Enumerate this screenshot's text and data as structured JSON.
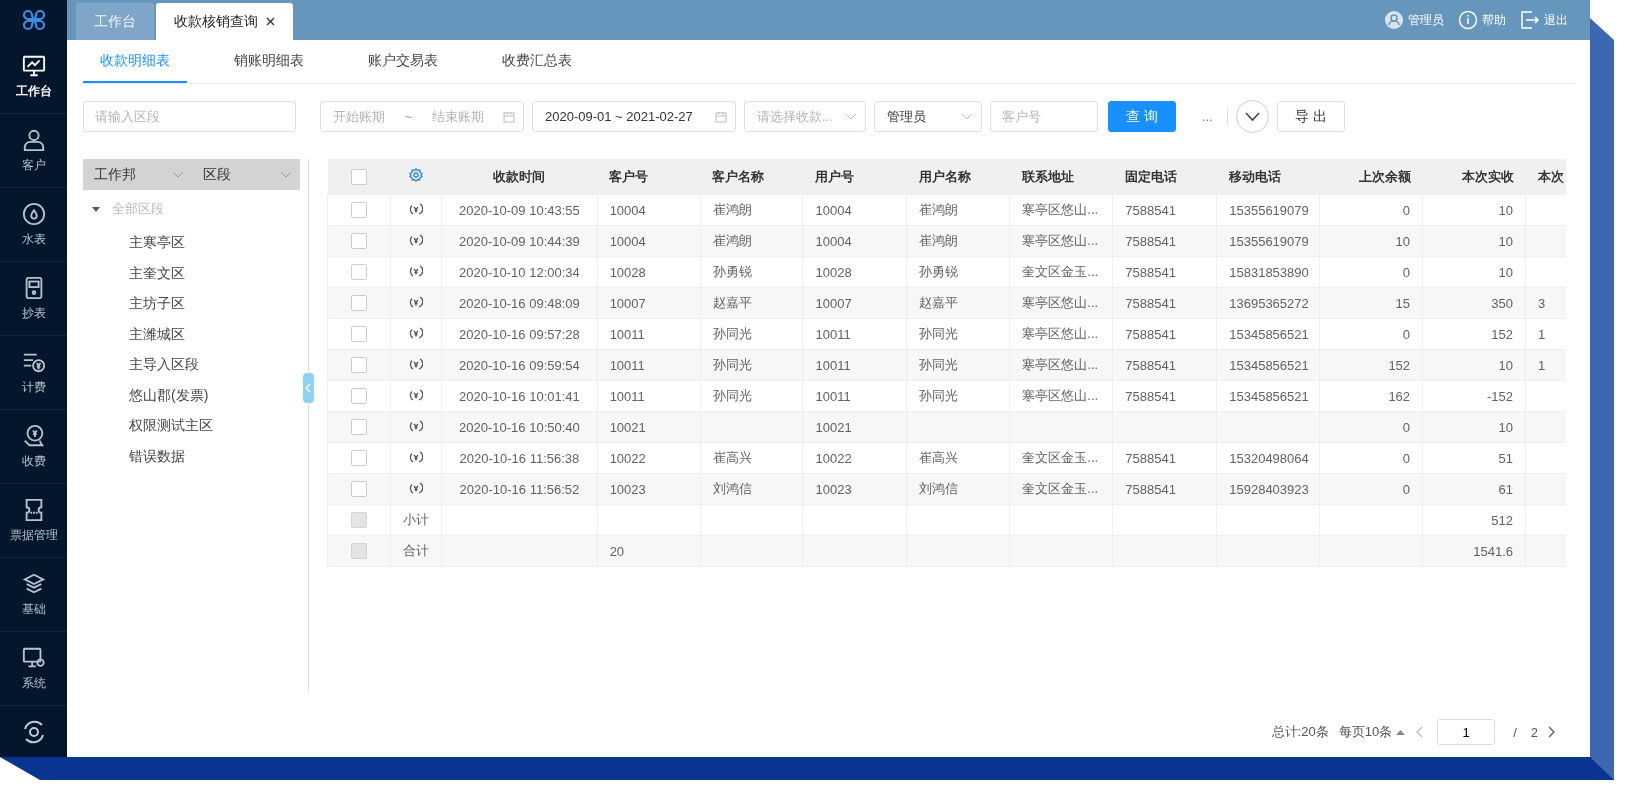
{
  "sidebar": {
    "items": [
      {
        "label": "工作台",
        "selected": true
      },
      {
        "label": "客户",
        "selected": false
      },
      {
        "label": "水表",
        "selected": false
      },
      {
        "label": "抄表",
        "selected": false
      },
      {
        "label": "计费",
        "selected": false
      },
      {
        "label": "收费",
        "selected": false
      },
      {
        "label": "票据管理",
        "selected": false
      },
      {
        "label": "基础",
        "selected": false
      },
      {
        "label": "系统",
        "selected": false
      }
    ]
  },
  "tabs": [
    {
      "label": "工作台",
      "selected": false,
      "closable": false
    },
    {
      "label": "收款核销查询",
      "selected": true,
      "closable": true
    }
  ],
  "user_menu": [
    {
      "label": "管理员"
    },
    {
      "label": "帮助"
    },
    {
      "label": "退出"
    }
  ],
  "subtabs": [
    {
      "label": "收款明细表",
      "selected": true
    },
    {
      "label": "销账明细表",
      "selected": false
    },
    {
      "label": "账户交易表",
      "selected": false
    },
    {
      "label": "收费汇总表",
      "selected": false
    }
  ],
  "filters": {
    "region": {
      "placeholder": "请输入区段"
    },
    "period": {
      "start_placeholder": "开始账期",
      "separator": "~",
      "end_placeholder": "结束账期"
    },
    "date_range": {
      "value": "2020-09-01 ~ 2021-02-27"
    },
    "payment_select": {
      "placeholder": "请选择收款..."
    },
    "operator_select": {
      "value": "管理员"
    },
    "customer": {
      "placeholder": "客户号"
    },
    "query_button": "查 询",
    "more": "...",
    "export_button": "导 出"
  },
  "left_panel": {
    "selects": [
      "工作邦",
      "区段"
    ],
    "tree": {
      "label": "全部区段",
      "expanded": true,
      "disabled": true,
      "children": [
        {
          "label": "主寒亭区"
        },
        {
          "label": "主奎文区"
        },
        {
          "label": "主坊子区"
        },
        {
          "label": "主潍城区"
        },
        {
          "label": "主导入区段"
        },
        {
          "label": "悠山郡(发票)"
        },
        {
          "label": "权限测试主区"
        },
        {
          "label": "错误数据"
        }
      ]
    }
  },
  "table": {
    "columns": [
      "收款时间",
      "客户号",
      "客户名称",
      "用户号",
      "用户名称",
      "联系地址",
      "固定电话",
      "移动电话",
      "上次余额",
      "本次实收",
      "本次"
    ],
    "select_all_checked": false,
    "rows": [
      {
        "kind": "data",
        "checked": false,
        "disabled": false,
        "cells": [
          "2020-10-09 10:43:55",
          "10004",
          "崔鸿朗",
          "10004",
          "崔鸿朗",
          "寒亭区悠山...",
          "7588541",
          "15355619079",
          "0",
          "10",
          ""
        ]
      },
      {
        "kind": "data",
        "checked": false,
        "disabled": false,
        "cells": [
          "2020-10-09 10:44:39",
          "10004",
          "崔鸿朗",
          "10004",
          "崔鸿朗",
          "寒亭区悠山...",
          "7588541",
          "15355619079",
          "10",
          "10",
          ""
        ]
      },
      {
        "kind": "data",
        "checked": false,
        "disabled": false,
        "cells": [
          "2020-10-10 12:00:34",
          "10028",
          "孙勇锐",
          "10028",
          "孙勇锐",
          "奎文区金玉...",
          "7588541",
          "15831853890",
          "0",
          "10",
          ""
        ]
      },
      {
        "kind": "data",
        "checked": false,
        "disabled": false,
        "cells": [
          "2020-10-16 09:48:09",
          "10007",
          "赵嘉平",
          "10007",
          "赵嘉平",
          "寒亭区悠山...",
          "7588541",
          "13695365272",
          "15",
          "350",
          "3"
        ]
      },
      {
        "kind": "data",
        "checked": false,
        "disabled": false,
        "cells": [
          "2020-10-16 09:57:28",
          "10011",
          "孙同光",
          "10011",
          "孙同光",
          "寒亭区悠山...",
          "7588541",
          "15345856521",
          "0",
          "152",
          "1"
        ]
      },
      {
        "kind": "data",
        "checked": false,
        "disabled": false,
        "cells": [
          "2020-10-16 09:59:54",
          "10011",
          "孙同光",
          "10011",
          "孙同光",
          "寒亭区悠山...",
          "7588541",
          "15345856521",
          "152",
          "10",
          "1"
        ]
      },
      {
        "kind": "data",
        "checked": false,
        "disabled": false,
        "cells": [
          "2020-10-16 10:01:41",
          "10011",
          "孙同光",
          "10011",
          "孙同光",
          "寒亭区悠山...",
          "7588541",
          "15345856521",
          "162",
          "-152",
          ""
        ]
      },
      {
        "kind": "data",
        "checked": false,
        "disabled": false,
        "cells": [
          "2020-10-16 10:50:40",
          "10021",
          "",
          "10021",
          "",
          "",
          "",
          "",
          "0",
          "10",
          ""
        ]
      },
      {
        "kind": "data",
        "checked": false,
        "disabled": false,
        "cells": [
          "2020-10-16 11:56:38",
          "10022",
          "崔高兴",
          "10022",
          "崔高兴",
          "奎文区金玉...",
          "7588541",
          "15320498064",
          "0",
          "51",
          ""
        ]
      },
      {
        "kind": "data",
        "checked": false,
        "disabled": false,
        "cells": [
          "2020-10-16 11:56:52",
          "10023",
          "刘鸿信",
          "10023",
          "刘鸿信",
          "奎文区金玉...",
          "7588541",
          "15928403923",
          "0",
          "61",
          ""
        ]
      },
      {
        "kind": "summary",
        "label": "小计",
        "checked": false,
        "disabled": true,
        "cells": [
          "",
          "",
          "",
          "",
          "",
          "",
          "",
          "",
          "",
          "512",
          ""
        ]
      },
      {
        "kind": "summary",
        "label": "合计",
        "checked": false,
        "disabled": true,
        "cells": [
          "",
          "20",
          "",
          "",
          "",
          "",
          "",
          "",
          "",
          "1541.6",
          ""
        ]
      }
    ]
  },
  "pagination": {
    "total": "总计:20条",
    "page_size": "每页10条",
    "page": "1",
    "separator": "/",
    "pages": "2"
  }
}
